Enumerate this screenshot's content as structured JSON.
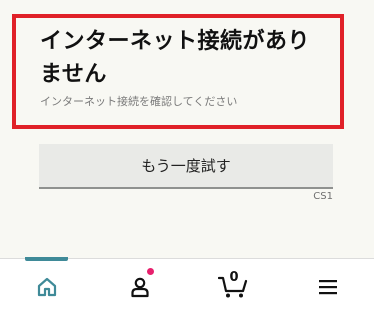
{
  "error": {
    "title": "インターネット接続がありません",
    "subtitle": "インターネット接続を確認してください",
    "border_color": "#e02128"
  },
  "retry": {
    "label": "もう一度試す"
  },
  "error_code": "CS1",
  "bottom_nav": {
    "active_color": "#3f8a98",
    "items": [
      {
        "name": "home",
        "icon": "home-icon",
        "active": true
      },
      {
        "name": "account",
        "icon": "user-icon",
        "has_notification": true,
        "notification_color": "#e7206d"
      },
      {
        "name": "cart",
        "icon": "cart-icon",
        "count": "0"
      },
      {
        "name": "menu",
        "icon": "hamburger-menu-icon"
      }
    ]
  }
}
